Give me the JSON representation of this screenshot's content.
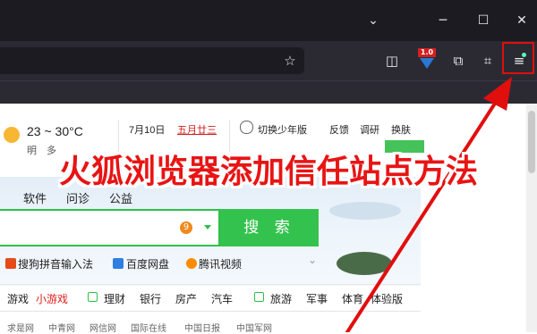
{
  "window": {
    "minimize": "─",
    "restore": "☐",
    "close": "✕",
    "tab_list": "⌄"
  },
  "toolbar": {
    "bookmark_star": "☆",
    "pocket": "◫",
    "badge_text": "1.0",
    "extensions": "⧉",
    "crop": "⌗",
    "menu": "≡"
  },
  "weather": {
    "temp": "23 ~ 30°C",
    "day_prefix": "明",
    "note": "多"
  },
  "date": {
    "solar": "7月10日",
    "lunar": "五月廿三"
  },
  "header_links": {
    "switch_youth": "切换少年版",
    "feedback": "反馈",
    "survey": "调研",
    "change_skin": "换肤"
  },
  "category_tabs": [
    "软件",
    "问诊",
    "公益"
  ],
  "search": {
    "button_label": "搜 索",
    "badge": "9"
  },
  "quick_links": [
    {
      "label": "搜狗拼音输入法",
      "icon_color": "#e64a19"
    },
    {
      "label": "百度网盘",
      "icon_color": "#2f7fe0"
    },
    {
      "label": "腾讯视频",
      "icon_color": "#ff8a00"
    }
  ],
  "nav_row": {
    "game": "游戏",
    "small_game": "小游戏",
    "finance": "理财",
    "bank": "银行",
    "house": "房产",
    "car": "汽车",
    "travel": "旅游",
    "military": "军事",
    "sports": "体育",
    "sports_edition": "体验版"
  },
  "site_links": [
    "求是网",
    "中青网",
    "网信网",
    "国际在线",
    "中国日报",
    "中国军网"
  ],
  "overlay_title": "火狐浏览器添加信任站点方法",
  "colors": {
    "accent_green": "#34c24e",
    "annotation_red": "#e10e0e",
    "title_red": "#e81414"
  }
}
